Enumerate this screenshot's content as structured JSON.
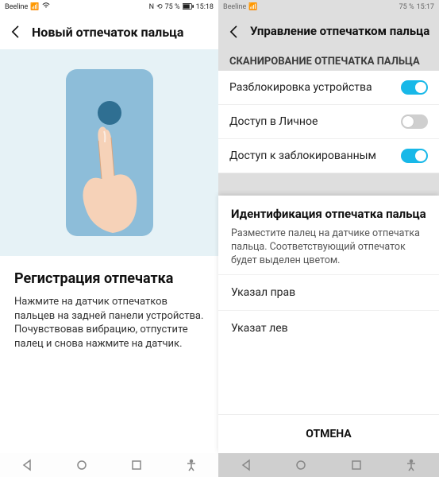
{
  "left": {
    "status": {
      "carrier": "Beeline",
      "battery": "75 %",
      "time": "15:18",
      "nfc": "N"
    },
    "title": "Новый отпечаток пальца",
    "reg_title": "Регистрация отпечатка",
    "reg_body": "Нажмите на датчик отпечатков пальцев на задней панели устройства. Почувствовав вибрацию, отпустите палец и снова нажмите на датчик."
  },
  "right": {
    "status": {
      "carrier": "Beeline",
      "battery": "75 %",
      "time": "15:17"
    },
    "title": "Управление отпечатком пальца",
    "section": "СКАНИРОВАНИЕ ОТПЕЧАТКА ПАЛЬЦА",
    "settings": [
      {
        "label": "Разблокировка устройства",
        "on": true
      },
      {
        "label": "Доступ в Личное",
        "on": false
      },
      {
        "label": "Доступ к заблокированным",
        "on": true
      }
    ],
    "dialog": {
      "title": "Идентификация отпечатка пальца",
      "body": "Разместите палец на датчике отпечатка пальца. Соответству­ющий отпечаток будет выделен цветом.",
      "items": [
        "Указал прав",
        "Указат лев"
      ],
      "cancel": "ОТМЕНА"
    }
  }
}
